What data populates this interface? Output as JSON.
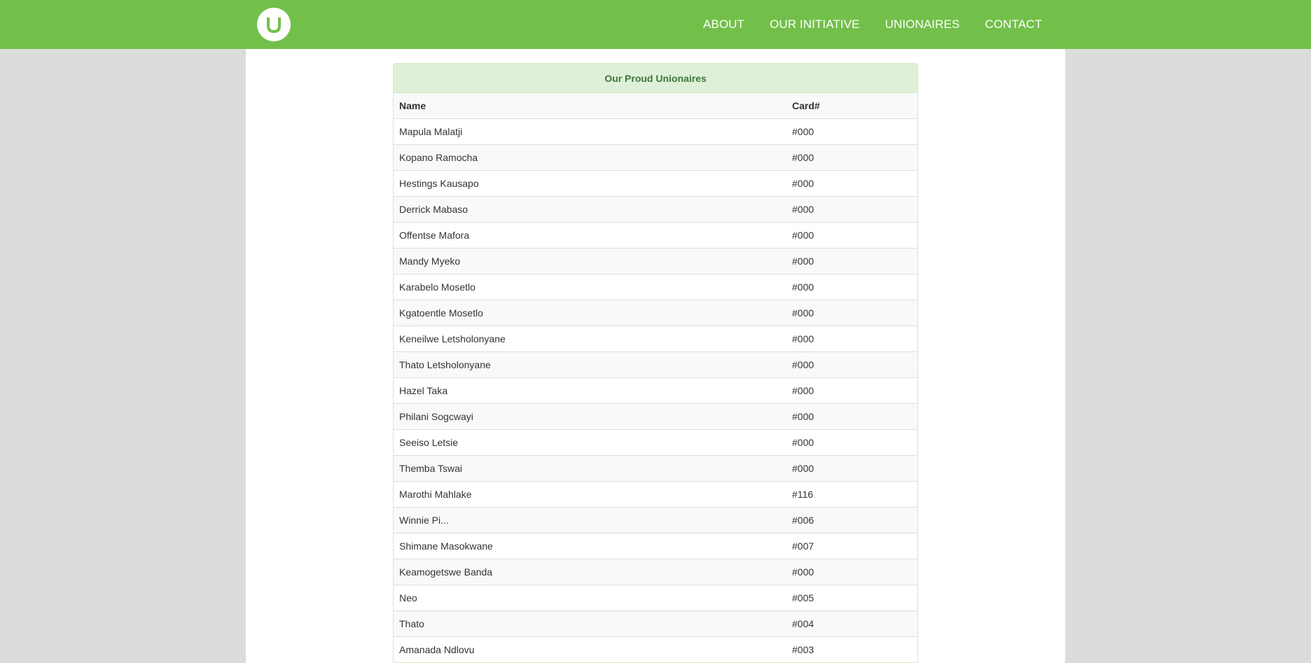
{
  "header": {
    "logo_letter": "U",
    "nav": [
      {
        "label": "ABOUT"
      },
      {
        "label": "OUR INITIATIVE"
      },
      {
        "label": "UNIONAIRES"
      },
      {
        "label": "CONTACT"
      }
    ],
    "colors": {
      "navbar": "#72c04a",
      "logo": "#72c04a"
    }
  },
  "panel": {
    "title": "Our Proud Unionaires",
    "columns": {
      "name": "Name",
      "card": "Card#"
    },
    "rows": [
      {
        "name": "Mapula Malatji",
        "card": "#000"
      },
      {
        "name": "Kopano Ramocha",
        "card": "#000"
      },
      {
        "name": "Hestings Kausapo",
        "card": "#000"
      },
      {
        "name": "Derrick Mabaso",
        "card": "#000"
      },
      {
        "name": "Offentse Mafora",
        "card": "#000"
      },
      {
        "name": "Mandy Myeko",
        "card": "#000"
      },
      {
        "name": "Karabelo Mosetlo",
        "card": "#000"
      },
      {
        "name": "Kgatoentle Mosetlo",
        "card": "#000"
      },
      {
        "name": "Keneilwe Letsholonyane",
        "card": "#000"
      },
      {
        "name": "Thato Letsholonyane",
        "card": "#000"
      },
      {
        "name": "Hazel Taka",
        "card": "#000"
      },
      {
        "name": "Philani Sogcwayi",
        "card": "#000"
      },
      {
        "name": "Seeiso Letsie",
        "card": "#000"
      },
      {
        "name": "Themba Tswai",
        "card": "#000"
      },
      {
        "name": "Marothi Mahlake",
        "card": "#116"
      },
      {
        "name": "Winnie Pi...",
        "card": "#006"
      },
      {
        "name": "Shimane Masokwane",
        "card": "#007"
      },
      {
        "name": "Keamogetswe Banda",
        "card": "#000"
      },
      {
        "name": "Neo",
        "card": "#005"
      },
      {
        "name": "Thato",
        "card": "#004"
      },
      {
        "name": "Amanada Ndlovu",
        "card": "#003"
      }
    ]
  }
}
